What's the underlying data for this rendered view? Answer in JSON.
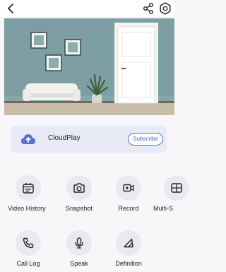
{
  "cloud": {
    "label": "CloudPlay",
    "button": "Subscribe"
  },
  "features": [
    {
      "label": "Video History",
      "icon": "calendar-icon"
    },
    {
      "label": "Snapshot",
      "icon": "camera-icon"
    },
    {
      "label": "Record",
      "icon": "video-record-icon"
    },
    {
      "label": "Multi-S",
      "icon": "multi-screen-icon"
    },
    {
      "label": "Call Log",
      "icon": "phone-icon"
    },
    {
      "label": "Speak",
      "icon": "microphone-icon"
    },
    {
      "label": "Definition",
      "icon": "definition-icon"
    }
  ],
  "colors": {
    "accent": "#4d61c2",
    "card": "#e8ebf6",
    "feature_bg": "#e9eaee"
  }
}
